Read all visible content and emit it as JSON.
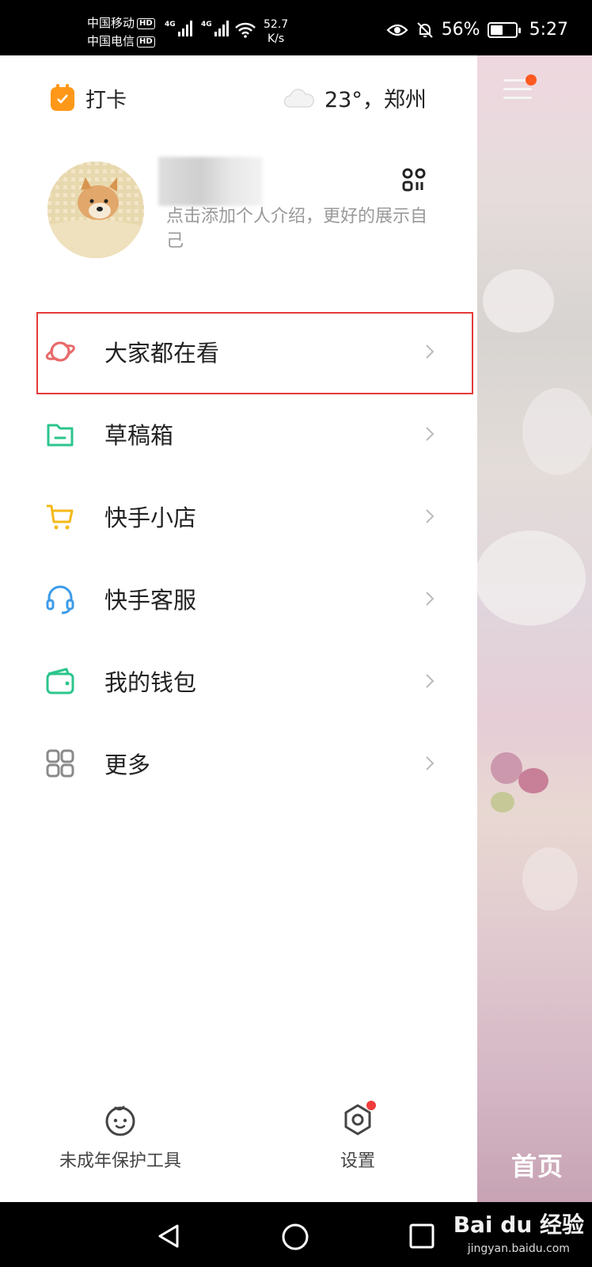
{
  "status_bar": {
    "carrier1": "中国移动",
    "carrier2": "中国电信",
    "hd": "HD",
    "network": "4G",
    "speed_value": "52.7",
    "speed_unit": "K/s",
    "battery": "56%",
    "battery_level": 0.56,
    "time": "5:27"
  },
  "header": {
    "checkin_label": "打卡",
    "weather": "23°，郑州"
  },
  "profile": {
    "intro": "点击添加个人介绍，更好的展示自己"
  },
  "menu": {
    "items": [
      {
        "label": "大家都在看",
        "icon": "planet-icon",
        "color": "#e86a6a"
      },
      {
        "label": "草稿箱",
        "icon": "folder-icon",
        "color": "#2cc58c"
      },
      {
        "label": "快手小店",
        "icon": "cart-icon",
        "color": "#f5b917"
      },
      {
        "label": "快手客服",
        "icon": "headset-icon",
        "color": "#3c9be8"
      },
      {
        "label": "我的钱包",
        "icon": "wallet-icon",
        "color": "#2cc58c"
      },
      {
        "label": "更多",
        "icon": "grid-icon",
        "color": "#8a8a8a"
      }
    ]
  },
  "bottom_tools": {
    "minor_protection": "未成年保护工具",
    "settings": "设置"
  },
  "background": {
    "home_tab": "首页"
  },
  "watermark": {
    "text": "Bai du 经验",
    "url": "jingyan.baidu.com"
  },
  "colors": {
    "accent_orange": "#ff9818",
    "highlight_red": "#e53a3a",
    "notification": "#fe5a1f"
  }
}
